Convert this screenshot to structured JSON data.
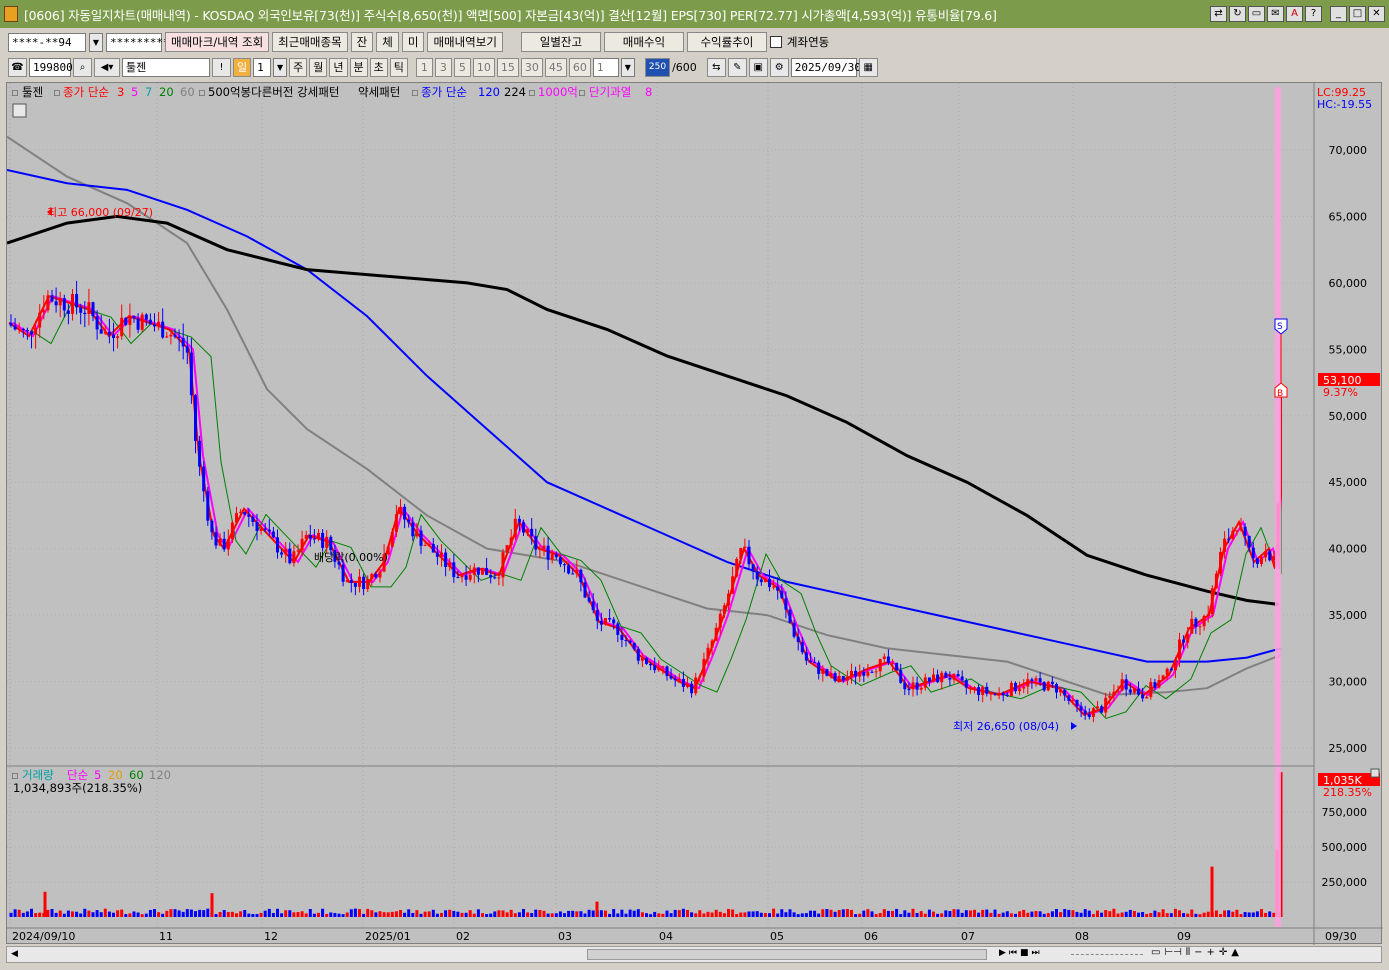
{
  "window": {
    "title": "[0606] 자동일지차트(매매내역) - KOSDAQ 외국인보유[73(천)] 주식수[8,650(천)] 액면[500] 자본금[43(억)] 결산[12월] EPS[730] PER[72.77] 시가총액[4,593(억)] 유통비율[79.6]",
    "buttons": [
      "⇄",
      "↻",
      "▭",
      "✉",
      "A",
      "?",
      "_",
      "□",
      "✕"
    ]
  },
  "toolbar1": {
    "account": "****-**94",
    "password": "*********",
    "btn_markers": "매매마크/내역 조회",
    "btn_recent": "최근매매종목",
    "btn_jan": "잔",
    "btn_che": "체",
    "btn_mi": "미",
    "btn_history": "매매내역보기",
    "btn_daily": "일별잔고",
    "btn_profit": "매매수익",
    "btn_return": "수익률추이",
    "chk_link": "계좌연동"
  },
  "toolbar2": {
    "code": "199800",
    "name": "툴젠",
    "period_sel": "일",
    "period_num": "1",
    "periods": [
      "주",
      "월",
      "년",
      "분",
      "초",
      "틱"
    ],
    "intervals": [
      "1",
      "3",
      "5",
      "10",
      "15",
      "30",
      "45",
      "60"
    ],
    "interval_value": "1",
    "count_badge": "250",
    "count_total": "/600",
    "date": "2025/09/30"
  },
  "legend": {
    "name": "툴젠",
    "ma_label": "종가 단순",
    "ma_periods": [
      "3",
      "5",
      "7",
      "20",
      "60"
    ],
    "pattern_labels": [
      "500억봉다른버전 강세패턴",
      "약세패턴"
    ],
    "ma2_label": "종가 단순",
    "ma2_periods": [
      "120",
      "224"
    ],
    "extra": "1000억",
    "overheat_label": "단기과열",
    "overheat_val": "8"
  },
  "readouts": {
    "lc": "LC:99.25",
    "hc": "HC:-19.55",
    "price_tag": "53,100",
    "price_pct": "9.37%",
    "high_label": "최고 66,000 (09/27)",
    "low_label": "최저 26,650 (08/04)",
    "dividend_label": "배당락(0.00%)",
    "marker_s": "S",
    "marker_b": "B"
  },
  "volume": {
    "legend_name": "거래량",
    "ma_label": "단순",
    "periods": [
      "5",
      "20",
      "60",
      "120"
    ],
    "readout": "1,034,893주(218.35%)",
    "tag": "1,035K",
    "tag_pct": "218.35%"
  },
  "axis": {
    "price_ticks": [
      "70,000",
      "65,000",
      "60,000",
      "55,000",
      "50,000",
      "45,000",
      "40,000",
      "35,000",
      "30,000",
      "25,000"
    ],
    "volume_ticks": [
      "750,000",
      "500,000",
      "250,000"
    ],
    "x_labels": [
      "2024/09/10",
      "11",
      "12",
      "2025/01",
      "02",
      "03",
      "04",
      "05",
      "06",
      "07",
      "08",
      "09"
    ],
    "x_last": "09/30"
  },
  "colors": {
    "up": "#ff0000",
    "down": "#0000ff",
    "ma3": "#ff0000",
    "ma5": "#ff00ff",
    "ma20": "#008000",
    "ma60": "#808080",
    "ma120": "#0000ff",
    "ma224": "#000000"
  }
}
